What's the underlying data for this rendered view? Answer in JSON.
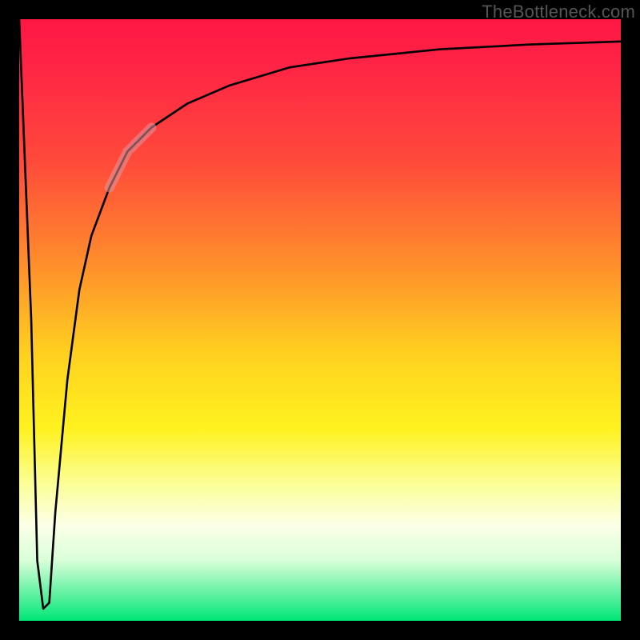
{
  "watermark": "TheBottleneck.com",
  "chart_data": {
    "type": "line",
    "title": "",
    "xlabel": "",
    "ylabel": "",
    "xlim": [
      0,
      100
    ],
    "ylim": [
      0,
      100
    ],
    "grid": false,
    "legend": false,
    "series": [
      {
        "name": "curve",
        "x": [
          0,
          2,
          3,
          4,
          5,
          6,
          8,
          10,
          12,
          15,
          18,
          22,
          28,
          35,
          45,
          55,
          70,
          85,
          100
        ],
        "y": [
          100,
          50,
          10,
          2,
          3,
          18,
          40,
          55,
          64,
          72,
          78,
          82,
          86,
          89,
          92,
          93.5,
          95,
          95.8,
          96.3
        ]
      }
    ],
    "highlight_segment": {
      "x_from": 15,
      "x_to": 22,
      "description": "faint rose overlay along the curve"
    }
  }
}
